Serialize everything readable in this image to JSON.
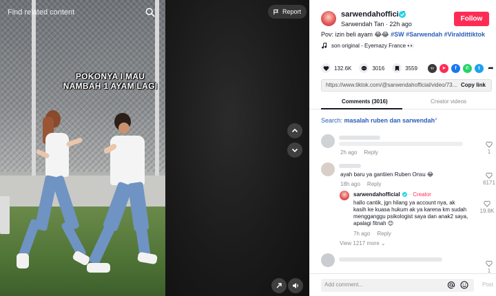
{
  "video": {
    "top_label": "Find related content",
    "caption": "POKONYA I MAU NAMBAH 1 AYAM LAGI",
    "report_label": "Report"
  },
  "author": {
    "username": "sarwendahofficial",
    "subtitle": "Sarwendah Tan · 22h ago",
    "follow_label": "Follow"
  },
  "post": {
    "description_prefix": "Pov: izin beli ayam 😂😂 ",
    "hashtags": [
      "#SW",
      "#Sarwendah",
      "#Viraldittiktok"
    ],
    "music": "son original - Eyemazy France 👀"
  },
  "actions": {
    "likes": "132.6K",
    "comments": "3016",
    "saves": "3559"
  },
  "share_icons": [
    {
      "name": "embed-icon",
      "color": "#3a3a3a",
      "glyph": "</>"
    },
    {
      "name": "send-icon",
      "color": "#fe2c55",
      "glyph": "➤"
    },
    {
      "name": "facebook-icon",
      "color": "#1877f2",
      "glyph": "f"
    },
    {
      "name": "whatsapp-icon",
      "color": "#25d366",
      "glyph": "✆"
    },
    {
      "name": "twitter-icon",
      "color": "#1da1f2",
      "glyph": "t"
    },
    {
      "name": "forward-icon",
      "color": "#161823",
      "glyph": "➦"
    }
  ],
  "link": {
    "url": "https://www.tiktok.com/@sarwendahofficial/video/73...",
    "copy_label": "Copy link"
  },
  "tabs": {
    "comments": "Comments (3016)",
    "creator_videos": "Creator videos"
  },
  "search_suggestion": {
    "prefix": "Search: ",
    "query": "masalah ruben dan sarwendah"
  },
  "comments": [
    {
      "text": "",
      "time": "2h ago",
      "reply": "Reply",
      "likes": "1"
    },
    {
      "text": "ayah baru ya gantiien Ruben Onsu 😂",
      "time": "18h ago",
      "reply": "Reply",
      "likes": "6171"
    },
    {
      "author": "sarwendahofficial",
      "badge": "Creator",
      "text_lines": [
        "hallo cantik, jgn hilang ya account nya, ak",
        "kasih ke kuasa hukum ak ya karena km sudah",
        "mengganggu psikologist saya dan anak2 saya,",
        "apalagi fitnah 😊"
      ],
      "time": "7h ago",
      "reply": "Reply",
      "likes": "19.8K"
    },
    {
      "text": "",
      "time": "",
      "reply": "",
      "likes": "1"
    }
  ],
  "view_more": "View 1217 more ⌄",
  "comment_box": {
    "placeholder": "Add comment...",
    "post_label": "Post"
  }
}
